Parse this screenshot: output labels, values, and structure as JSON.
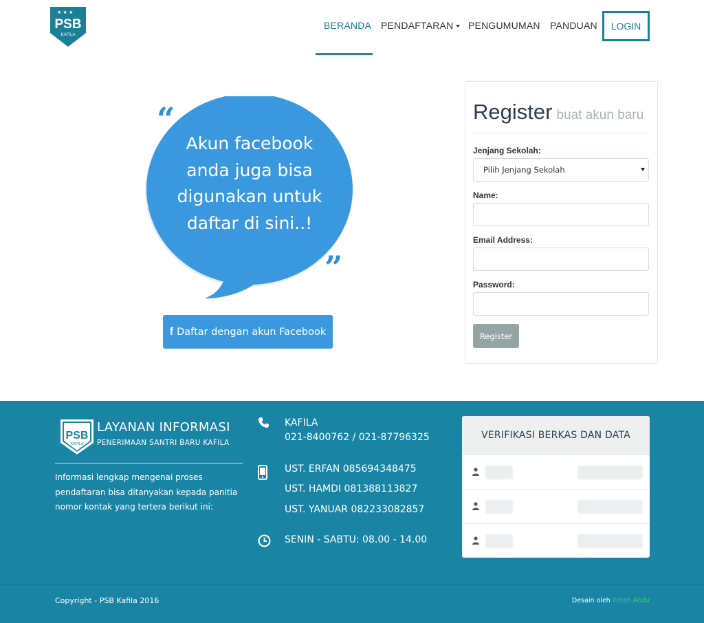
{
  "brand": {
    "logo_text": "PSB",
    "logo_subtext": "KAFILA"
  },
  "nav": {
    "items": [
      {
        "label": "BERANDA",
        "active": true
      },
      {
        "label": "PENDAFTARAN",
        "has_dropdown": true
      },
      {
        "label": "PENGUMUMAN"
      },
      {
        "label": "PANDUAN"
      }
    ],
    "login_label": "LOGIN"
  },
  "hero": {
    "bubble_text": "Akun facebook anda juga bisa digunakan untuk daftar di sini..!",
    "quote_open": "“",
    "quote_close": "”",
    "facebook_icon": "f",
    "facebook_button": "Daftar dengan akun Facebook"
  },
  "register": {
    "title": "Register",
    "subtitle": "buat akun baru",
    "level_label": "Jenjang Sekolah:",
    "level_value": "Pilih Jenjang Sekolah",
    "name_label": "Name:",
    "name_value": "",
    "email_label": "Email Address:",
    "email_value": "",
    "password_label": "Password:",
    "password_value": "",
    "submit_label": "Register"
  },
  "footer": {
    "title": "LAYANAN INFORMASI",
    "subtitle": "PENERIMAAN SANTRI BARU KAFILA",
    "description": "Informasi lengkap mengenai proses pendaftaran bisa ditanyakan kepada panitia nomor kontak yang tertera berikut ini:",
    "office_name": "KAFILA",
    "office_phones": "021-8400762 / 021-87796325",
    "contacts": [
      "UST. ERFAN 085694348475",
      "UST. HAMDI 081388113827",
      "UST. YANUAR 082233082857"
    ],
    "hours": "SENIN - SABTU: 08.00 - 14.00",
    "verification": {
      "title": "VERIFIKASI BERKAS DAN DATA",
      "rows": 3
    },
    "copyright": "Copyright - PSB Kafila 2016",
    "credit_prefix": "Desain oleh",
    "credit_name": "Ilman Abdu"
  },
  "colors": {
    "accent": "#1b7f96",
    "bubble": "#3a99de",
    "footer_bg": "#1a84a5",
    "submit_bg": "#95a5a6",
    "credit_link": "#2ecc71"
  },
  "icons": [
    "phone-icon",
    "mobile-icon",
    "clock-icon",
    "user-icon",
    "facebook-icon",
    "caret-down-icon"
  ]
}
